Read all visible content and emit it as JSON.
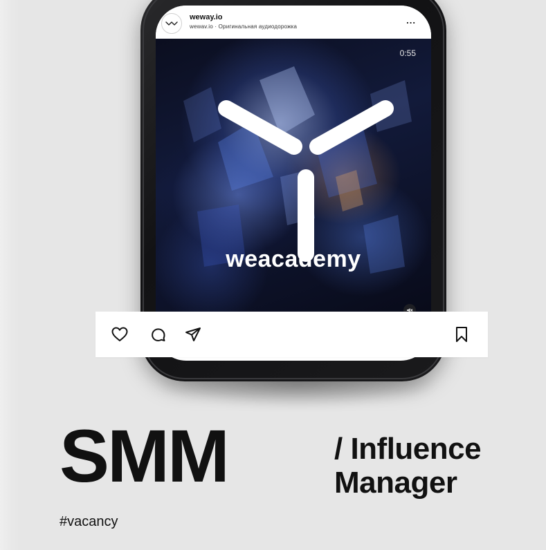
{
  "post": {
    "username": "weway.io",
    "audio_line": "wewav.io · Оригинальная аудиодорожка",
    "more_label": "...",
    "duration": "0:55",
    "brand_text": "weacademy",
    "icons": {
      "avatar": "weway-logo-icon",
      "more": "more-icon",
      "mute": "mute-icon",
      "like": "heart-icon",
      "comment": "comment-icon",
      "share": "send-icon",
      "save": "bookmark-icon"
    }
  },
  "headline": {
    "main": "SMM",
    "role_line_1": "/ Influence",
    "role_line_2": "Manager"
  },
  "hashtag": "#vacancy",
  "colors": {
    "background": "#e6e6e6",
    "text": "#111111",
    "phone": "#121214",
    "card": "#ffffff"
  }
}
